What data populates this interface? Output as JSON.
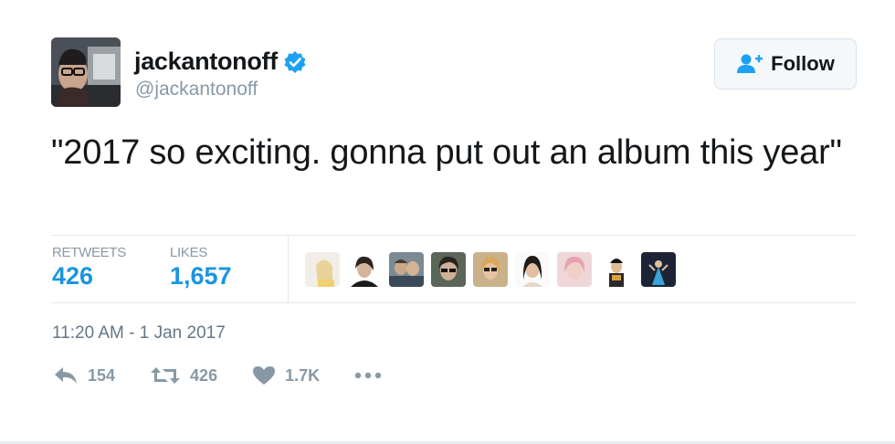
{
  "header": {
    "display_name": "jackantonoff",
    "handle": "@jackantonoff",
    "verified_icon": "verified-badge-icon",
    "follow_label": "Follow",
    "follow_icon": "add-user-icon",
    "accent_color": "#1b95e0"
  },
  "tweet": {
    "text": "\"2017 so exciting. gonna put out an album this year\""
  },
  "stats": {
    "retweets_label": "RETWEETS",
    "retweets_value": "426",
    "likes_label": "LIKES",
    "likes_value": "1,657",
    "liker_avatars_count": 9
  },
  "timestamp": "11:20 AM - 1 Jan 2017",
  "actions": {
    "reply_icon": "reply-icon",
    "reply_count": "154",
    "retweet_icon": "retweet-icon",
    "retweet_count": "426",
    "like_icon": "heart-icon",
    "like_count": "1.7K",
    "more_icon": "more-icon"
  }
}
